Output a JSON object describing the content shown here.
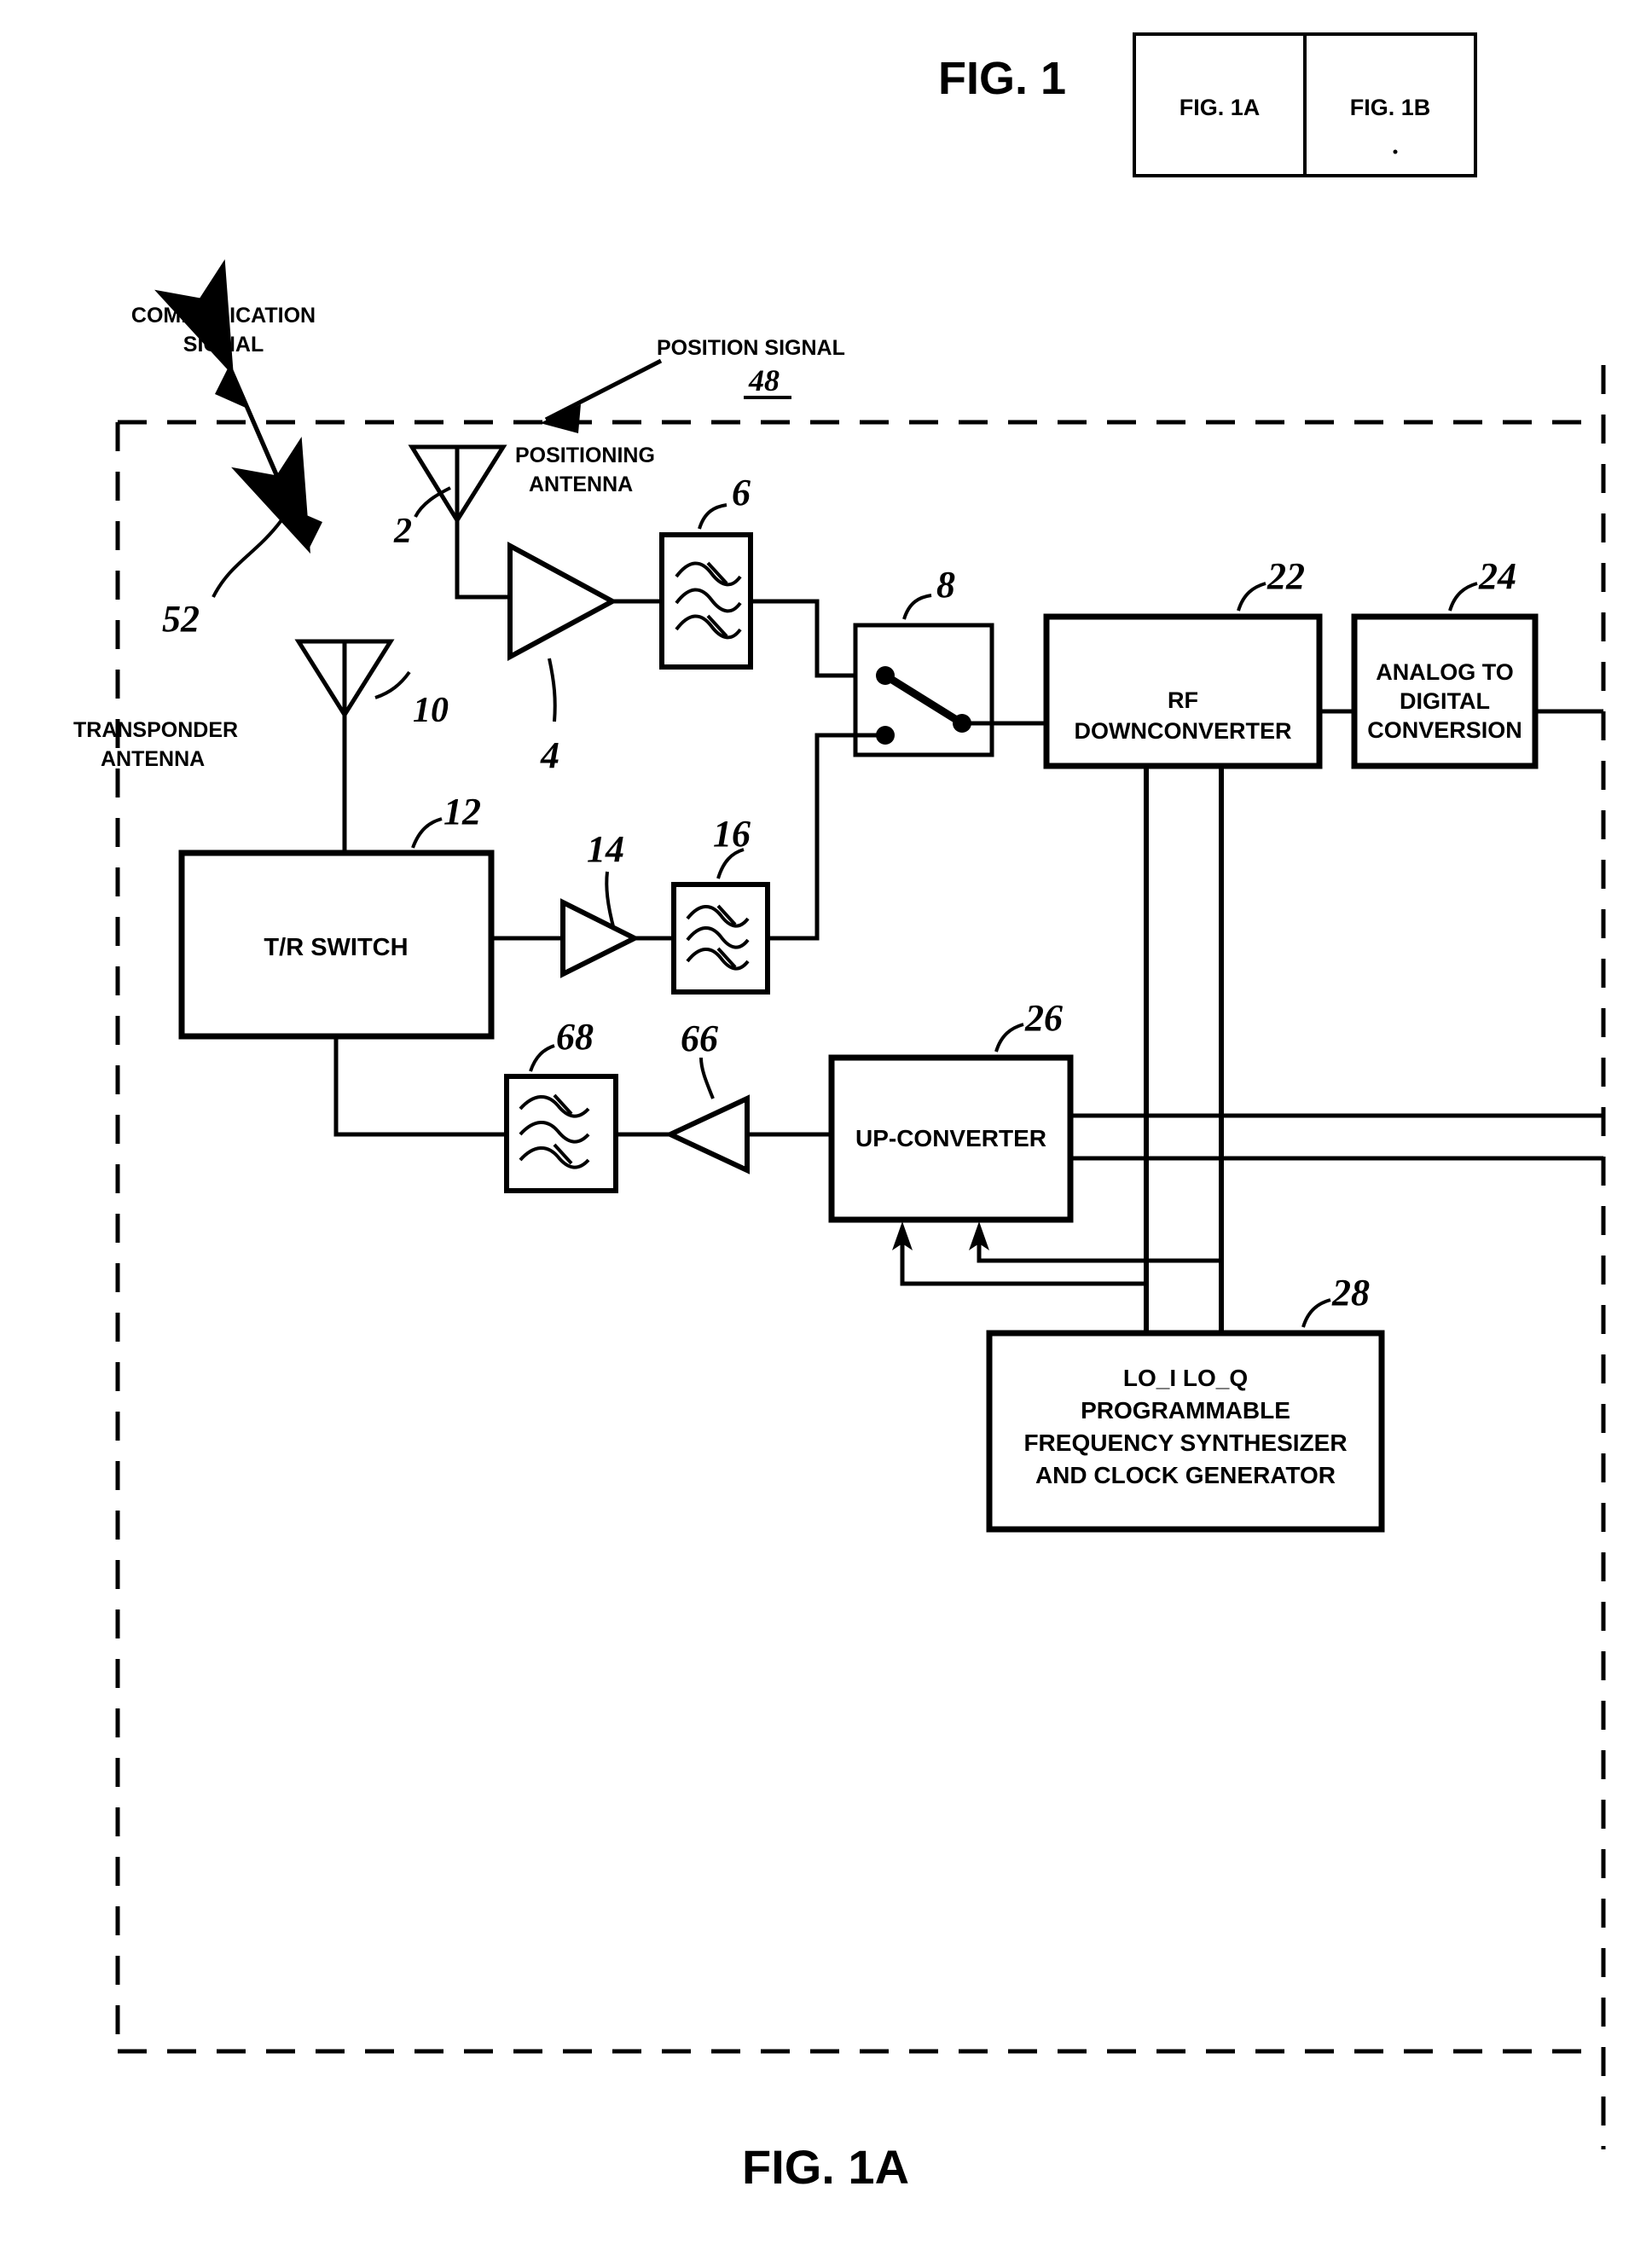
{
  "figure": {
    "main_title": "FIG. 1",
    "bottom_title": "FIG. 1A",
    "key_boxes": [
      "FIG. 1A",
      "FIG. 1B"
    ]
  },
  "annotations": {
    "communication_signal": "COMMUNICATION\nSIGNAL",
    "communication_signal_line1": "COMMUNICATION",
    "communication_signal_line2": "SIGNAL",
    "communication_signal_ref": "52",
    "position_signal": "POSITION  SIGNAL",
    "position_signal_ref": "48",
    "positioning_antenna_line1": "POSITIONING",
    "positioning_antenna_line2": "ANTENNA",
    "positioning_antenna_ref": "2",
    "transponder_antenna_line1": "TRANSPONDER",
    "transponder_antenna_line2": "ANTENNA",
    "transponder_antenna_ref": "10"
  },
  "blocks": [
    {
      "id": "amp4",
      "ref": "4",
      "label": "",
      "type": "amplifier"
    },
    {
      "id": "filt6",
      "ref": "6",
      "label": "",
      "type": "filter"
    },
    {
      "id": "sw8",
      "ref": "8",
      "label": "",
      "type": "switch"
    },
    {
      "id": "dc22",
      "ref": "22",
      "label_line1": "RF",
      "label_line2": "DOWNCONVERTER",
      "type": "box"
    },
    {
      "id": "adc24",
      "ref": "24",
      "label_line1": "ANALOG  TO",
      "label_line2": "DIGITAL",
      "label_line3": "CONVERSION",
      "type": "box"
    },
    {
      "id": "tr12",
      "ref": "12",
      "label": "T/R  SWITCH",
      "type": "box"
    },
    {
      "id": "amp14",
      "ref": "14",
      "label": "",
      "type": "amplifier"
    },
    {
      "id": "filt16",
      "ref": "16",
      "label": "",
      "type": "filter"
    },
    {
      "id": "filt68",
      "ref": "68",
      "label": "",
      "type": "filter"
    },
    {
      "id": "amp66",
      "ref": "66",
      "label": "",
      "type": "amplifier"
    },
    {
      "id": "uc26",
      "ref": "26",
      "label": "UP-CONVERTER",
      "type": "box"
    },
    {
      "id": "syn28",
      "ref": "28",
      "label_line1": "LO_I LO_Q",
      "label_line2": "PROGRAMMABLE",
      "label_line3": "FREQUENCY  SYNTHESIZER",
      "label_line4": "AND  CLOCK  GENERATOR",
      "type": "box"
    }
  ],
  "colors": {
    "ink": "#000000",
    "paper": "#ffffff"
  }
}
